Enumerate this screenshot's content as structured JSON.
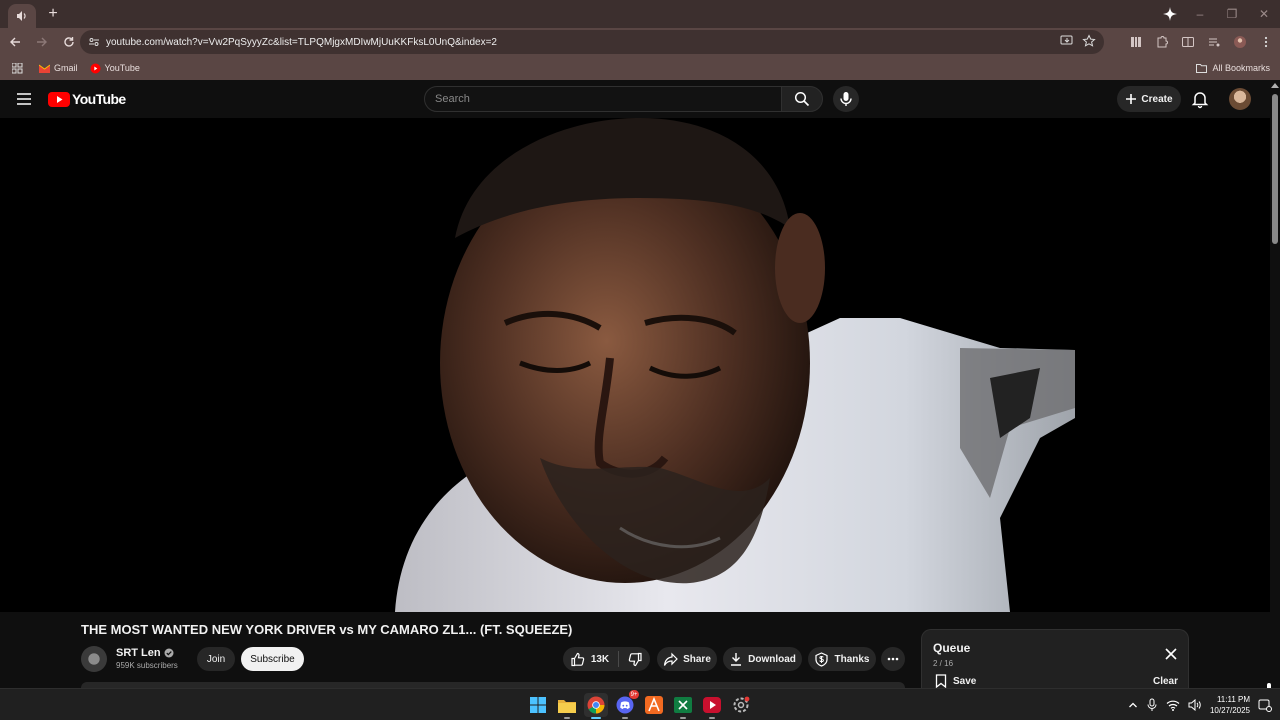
{
  "browser": {
    "url": "youtube.com/watch?v=Vw2PqSyyyZc&list=TLPQMjgxMDIwMjUuKKFksL0UnQ&index=2",
    "bookmarks": [
      {
        "label": "Gmail",
        "icon": "gmail-icon"
      },
      {
        "label": "YouTube",
        "icon": "youtube-icon"
      }
    ],
    "all_bookmarks_label": "All Bookmarks",
    "new_tab_label": "+"
  },
  "youtube": {
    "logo_text": "YouTube",
    "search_placeholder": "Search",
    "create_label": "Create",
    "brand_red": "#ff0000"
  },
  "video": {
    "title": "THE MOST WANTED NEW YORK DRIVER vs MY CAMARO ZL1... (FT. SQUEEZE)",
    "channel": "SRT Len",
    "subscribers": "959K subscribers",
    "join_label": "Join",
    "subscribe_label": "Subscribe",
    "likes": "13K",
    "share_label": "Share",
    "download_label": "Download",
    "thanks_label": "Thanks"
  },
  "queue": {
    "title": "Queue",
    "count": "2 / 16",
    "save_label": "Save",
    "clear_label": "Clear"
  },
  "taskbar": {
    "time": "11:11 PM",
    "date": "10/27/2025",
    "discord_badge": "9+",
    "accent": "#60cdff"
  }
}
